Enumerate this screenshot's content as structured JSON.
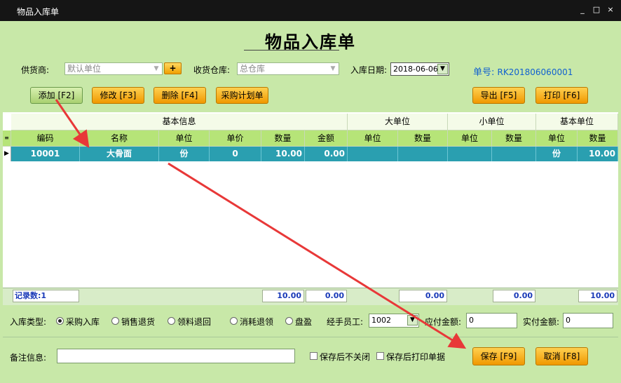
{
  "window": {
    "title": "物品入库单",
    "controls": [
      "_",
      "□",
      "×"
    ]
  },
  "form": {
    "heading": "物品入库单",
    "supplier_label": "供货商:",
    "supplier_value": "默认单位",
    "plus_label": "+",
    "warehouse_label": "收货仓库:",
    "warehouse_value": "总仓库",
    "date_label": "入库日期:",
    "date_value": "2018-06-06",
    "docno_label": "单号:",
    "docno_value": "RK201806060001"
  },
  "toolbar": {
    "add": "添加 [F2]",
    "edit": "修改 [F3]",
    "delete": "删除 [F4]",
    "purchase_plan": "采购计划单",
    "export": "导出 [F5]",
    "print": "打印 [F6]"
  },
  "grid": {
    "groups": [
      "基本信息",
      "大单位",
      "小单位",
      "基本单位"
    ],
    "columns": [
      "编码",
      "名称",
      "单位",
      "单价",
      "数量",
      "金额",
      "单位",
      "数量",
      "单位",
      "数量",
      "单位",
      "数量"
    ],
    "rows": [
      {
        "cells": [
          "10001",
          "大骨面",
          "份",
          "0",
          "10.00",
          "0.00",
          "",
          "",
          "",
          "",
          "份",
          "10.00"
        ]
      }
    ],
    "footer": {
      "record_count": "记录数:1",
      "qty": "10.00",
      "amount": "0.00",
      "big_qty": "0.00",
      "small_qty": "0.00",
      "base_qty": "10.00"
    }
  },
  "bottom": {
    "type_label": "入库类型:",
    "types": [
      "采购入库",
      "销售退货",
      "领料退回",
      "消耗退领",
      "盘盈"
    ],
    "handler_label": "经手员工:",
    "handler_value": "1002",
    "payable_label": "应付金额:",
    "payable_value": "0",
    "paid_label": "实付金额:",
    "paid_value": "0",
    "remark_label": "备注信息:",
    "keep_open": "保存后不关闭",
    "print_after": "保存后打印单据",
    "save": "保存 [F9]",
    "cancel": "取消 [F8]"
  },
  "colors": {
    "background": "#c8e8a8",
    "header_green": "#b6e478",
    "selected_row": "#2a9fb0",
    "button_orange": "#f8b020",
    "arrow_red": "#e83838",
    "docno_blue": "#1060d0"
  }
}
